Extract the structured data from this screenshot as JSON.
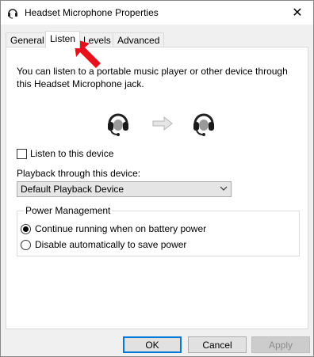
{
  "window": {
    "title": "Headset Microphone Properties",
    "close_glyph": "✕"
  },
  "tabs": [
    {
      "label": "General"
    },
    {
      "label": "Listen"
    },
    {
      "label": "Levels"
    },
    {
      "label": "Advanced"
    }
  ],
  "active_tab": "Listen",
  "listen": {
    "description": "You can listen to a portable music player or other device through this Headset Microphone jack.",
    "checkbox_label": "Listen to this device",
    "checkbox_checked": false,
    "playback_label": "Playback through this device:",
    "playback_value": "Default Playback Device"
  },
  "power": {
    "legend": "Power Management",
    "options": [
      {
        "label": "Continue running when on battery power",
        "selected": true
      },
      {
        "label": "Disable automatically to save power",
        "selected": false
      }
    ]
  },
  "buttons": {
    "ok": "OK",
    "cancel": "Cancel",
    "apply": "Apply"
  },
  "colors": {
    "accent": "#0078d7",
    "annotation_arrow": "#e8101c"
  },
  "icons": {
    "title": "headset-microphone-icon",
    "source_device": "headset-icon",
    "target_device": "headset-icon",
    "flow": "arrow-right-icon"
  }
}
